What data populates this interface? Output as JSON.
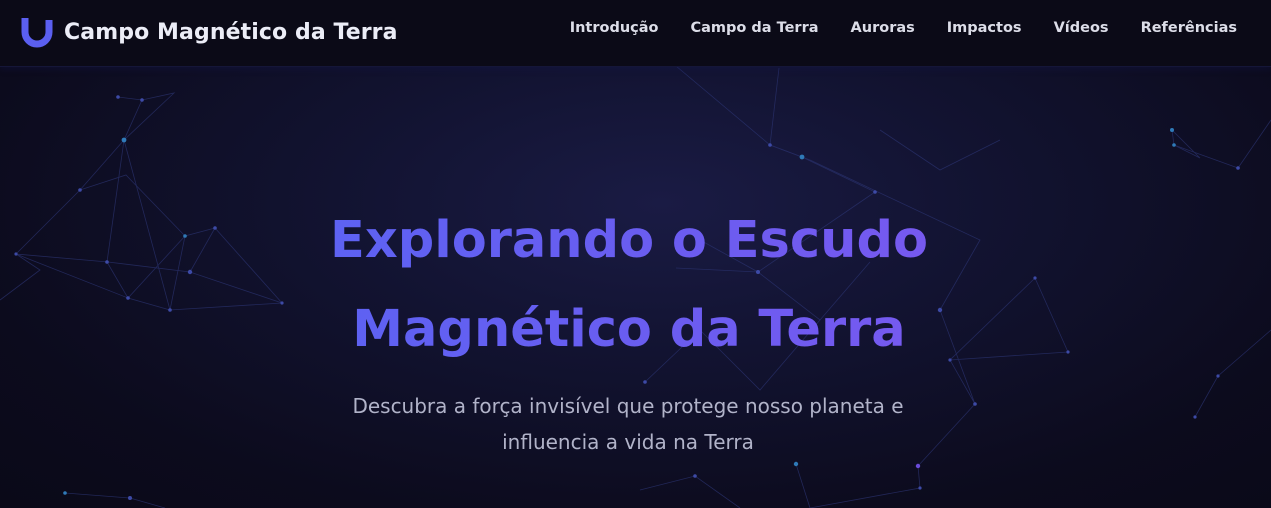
{
  "header": {
    "brand_icon": "magnet-icon",
    "brand_title": "Campo Magnético da Terra",
    "accent_color": "#5b5ff0"
  },
  "nav": {
    "items": [
      {
        "label": "Introdução"
      },
      {
        "label": "Campo da Terra"
      },
      {
        "label": "Auroras"
      },
      {
        "label": "Impactos"
      },
      {
        "label": "Vídeos"
      },
      {
        "label": "Referências"
      }
    ]
  },
  "hero": {
    "title_line1": "Explorando o Escudo",
    "title_line2": "Magnético da Terra",
    "subtitle_line1": "Descubra a força invisível que protege nosso planeta e",
    "subtitle_line2": "influencia a vida na Terra",
    "title_color": "#6263f1",
    "background_color": "#0c0b1d"
  }
}
